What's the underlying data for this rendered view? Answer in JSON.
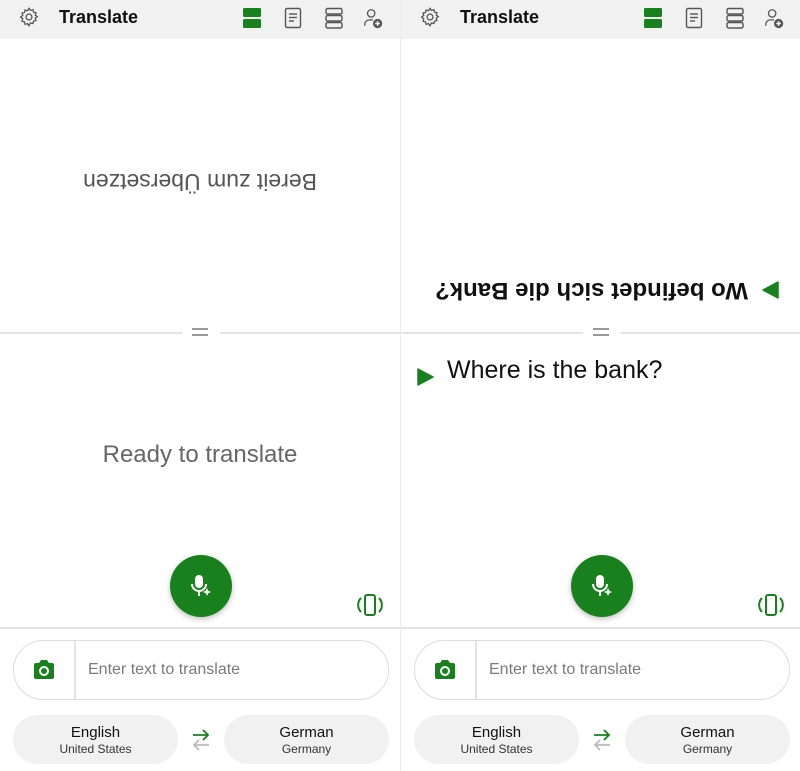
{
  "colors": {
    "accent": "#18801d",
    "topbar_bg": "#f1f1f1",
    "chip_bg": "#f1f1f1",
    "divider": "#e3e3e3"
  },
  "panes": [
    {
      "header": {
        "title": "Translate",
        "icons": [
          "gear-icon",
          "split-view-icon",
          "document-icon",
          "stacked-view-icon",
          "add-user-icon"
        ]
      },
      "upper": {
        "text": "Bereit zum Übersetzen",
        "has_play": false
      },
      "lower": {
        "text": "Ready to translate",
        "has_play": false
      },
      "input": {
        "value": "",
        "placeholder": "Enter text to translate"
      },
      "source_language": {
        "name": "English",
        "region": "United States"
      },
      "target_language": {
        "name": "German",
        "region": "Germany"
      }
    },
    {
      "header": {
        "title": "Translate",
        "icons": [
          "gear-icon",
          "split-view-icon",
          "document-icon",
          "stacked-view-icon",
          "add-user-icon"
        ]
      },
      "upper": {
        "text": "Wo befindet sich die Bank?",
        "has_play": true
      },
      "lower": {
        "text": "Where is the bank?",
        "has_play": true
      },
      "input": {
        "value": "",
        "placeholder": "Enter text to translate"
      },
      "source_language": {
        "name": "English",
        "region": "United States"
      },
      "target_language": {
        "name": "German",
        "region": "Germany"
      }
    }
  ]
}
